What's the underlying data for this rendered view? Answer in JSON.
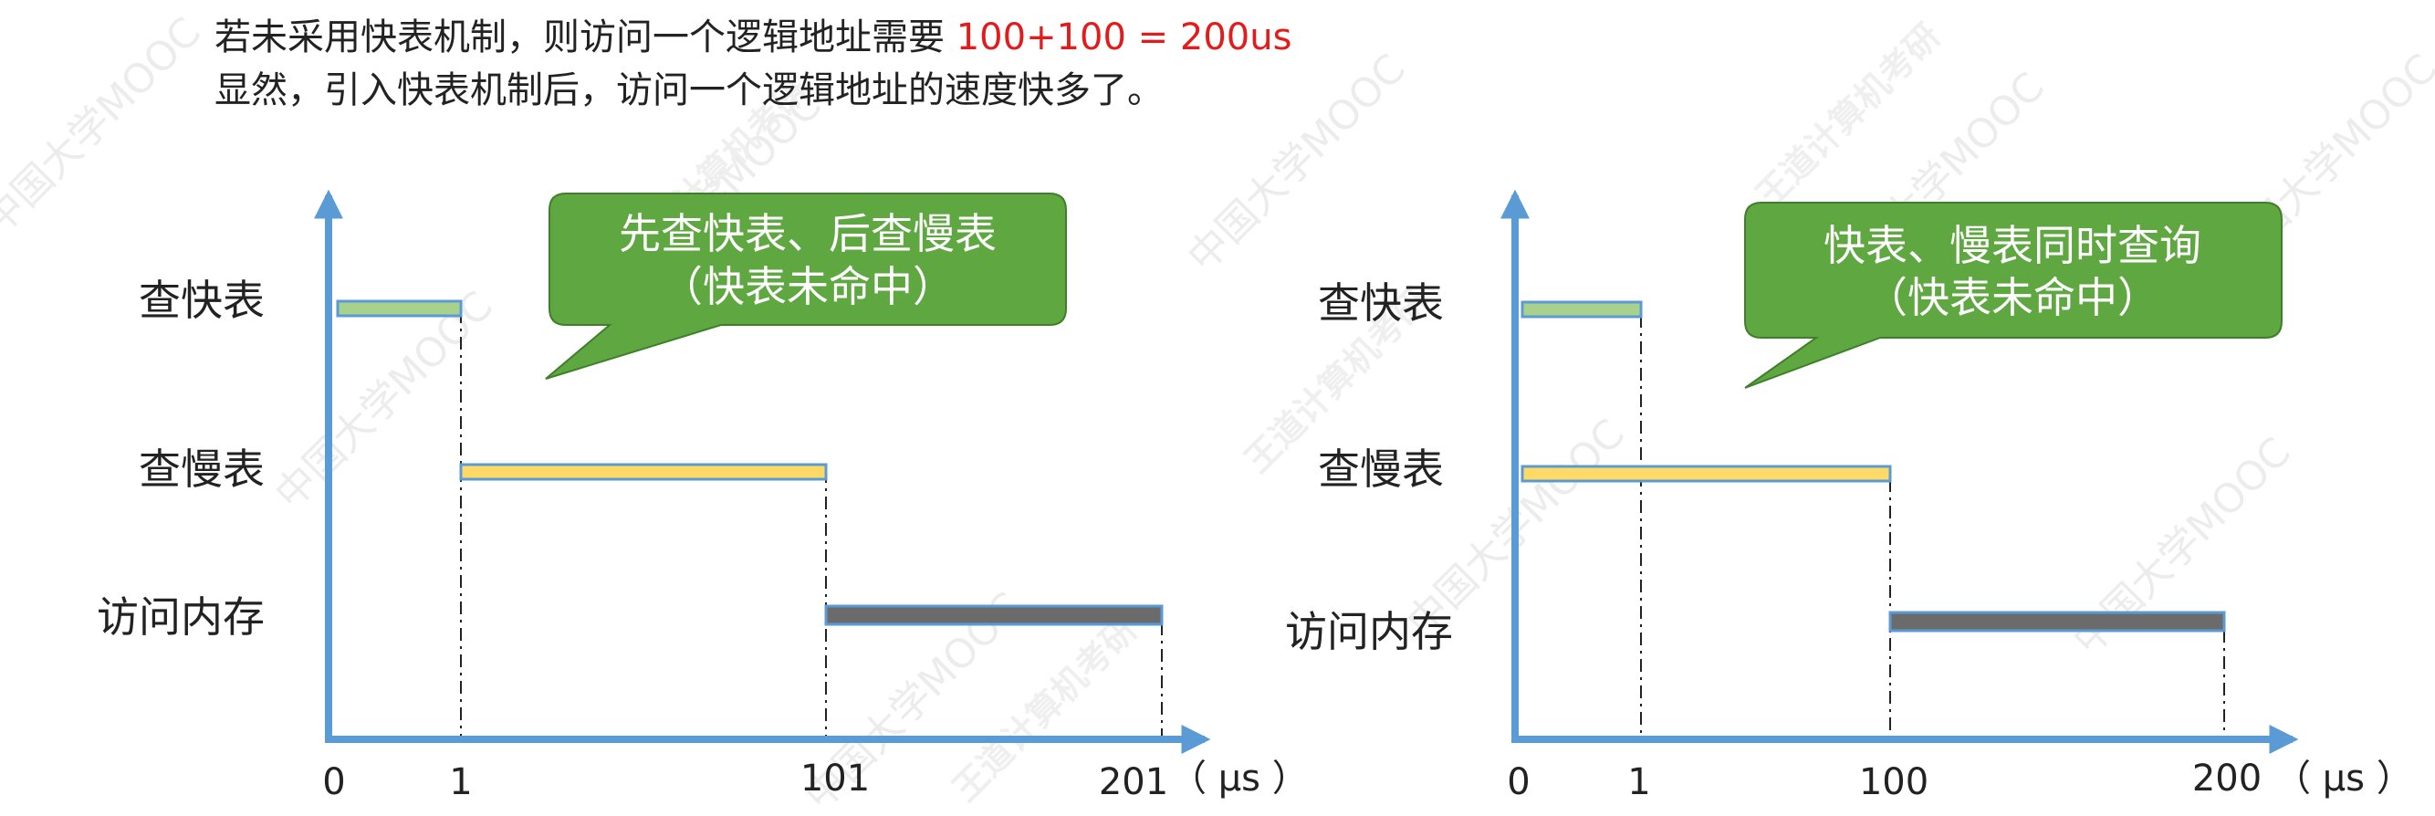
{
  "header": {
    "line1_text": "若未采用快表机制，则访问一个逻辑地址需要 ",
    "line1_formula": "100+100 = 200us",
    "line2_text": "显然，引入快表机制后，访问一个逻辑地址的速度快多了。"
  },
  "watermark": {
    "text": "中国大学MOOC",
    "brand": "王道计算机考研"
  },
  "left_diagram": {
    "callout_line1": "先查快表、后查慢表",
    "callout_line2": "（快表未命中）",
    "rows": [
      "查快表",
      "查慢表",
      "访问内存"
    ],
    "ticks": [
      "0",
      "1",
      "101",
      "201"
    ],
    "unit": "（ μs ）"
  },
  "right_diagram": {
    "callout_line1": "快表、慢表同时查询",
    "callout_line2": "（快表未命中）",
    "rows": [
      "查快表",
      "查慢表",
      "访问内存"
    ],
    "ticks": [
      "0",
      "1",
      "100",
      "200"
    ],
    "unit": "（ μs ）"
  },
  "colors": {
    "axis": "#5b9bd5",
    "fast_bar": "#a9d18e",
    "slow_bar": "#ffd966",
    "mem_bar": "#6b6b6b",
    "callout": "#5fa740",
    "formula": "#e31b1b"
  }
}
